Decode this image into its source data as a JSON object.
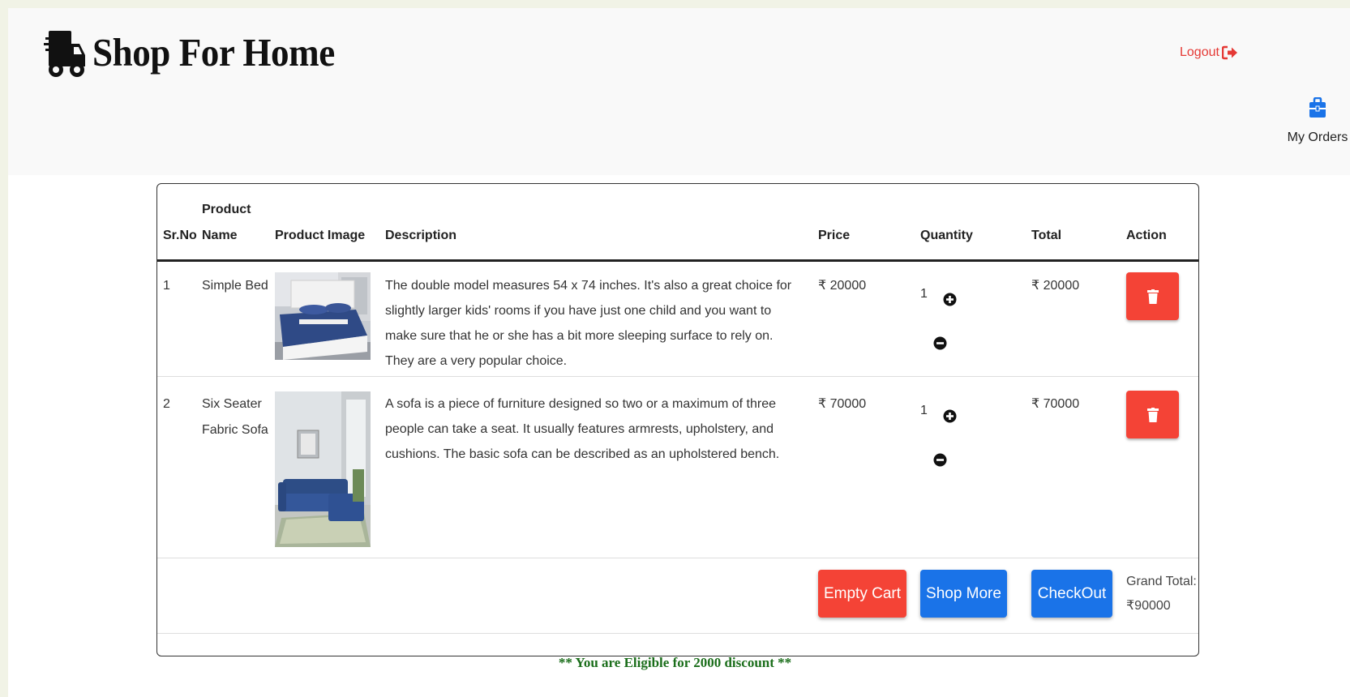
{
  "header": {
    "brand_title": "Shop For Home",
    "logout_label": "Logout",
    "my_orders_label": "My Orders"
  },
  "cart": {
    "columns": {
      "srno": "Sr.No",
      "product_name_line1": "Product",
      "product_name_line2": "Name",
      "product_image": "Product Image",
      "description": "Description",
      "price": "Price",
      "quantity": "Quantity",
      "total": "Total",
      "action": "Action"
    },
    "rows": [
      {
        "srno": "1",
        "name_line1": "Simple Bed",
        "name_line2": "",
        "description": "The double model measures 54 x 74 inches. It's also a great choice for slightly larger kids' rooms if you have just one child and you want to make sure that he or she has a bit more sleeping surface to rely on. They are a very popular choice.",
        "price": "₹ 20000",
        "quantity": "1",
        "total": "₹ 20000",
        "image_icon": "bed-product-image"
      },
      {
        "srno": "2",
        "name_line1": "Six Seater",
        "name_line2": "Fabric Sofa",
        "description": "A sofa is a piece of furniture designed so two or a maximum of three people can take a seat. It usually features armrests, upholstery, and cushions. The basic sofa can be described as an upholstered bench.",
        "price": "₹ 70000",
        "quantity": "1",
        "total": "₹ 70000",
        "image_icon": "sofa-product-image"
      }
    ],
    "buttons": {
      "empty_cart": "Empty Cart",
      "shop_more": "Shop More",
      "checkout": "CheckOut"
    },
    "grand_total_label": "Grand Total:",
    "grand_total_value": "₹90000"
  },
  "discount_message": "** You are Eligible for 2000 discount **",
  "colors": {
    "danger": "#f44336",
    "primary": "#1a73e8",
    "discount": "#1b6e1b",
    "order_icon": "#1a73e8"
  }
}
